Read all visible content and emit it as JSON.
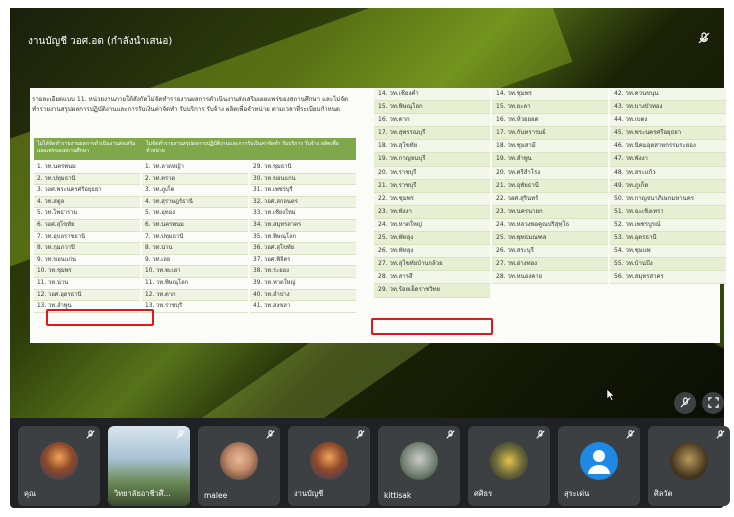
{
  "meeting": {
    "presenter_label": "งานบัญชี วอศ.อด (กำลังนำเสนอ)",
    "mic_off_icon": "mic-off-icon"
  },
  "slide": {
    "intro": "รายละเอียดแบบ 11. หน่วยงานภายใต้สังกัดไม่จัดทำรายงานผลการดำเนินงานส่งเสริมเผยแพร่ของสถานศึกษา และไม่จัดทำรายงานสรุปผลการปฏิบัติงานและการรับเงินค่าจัดทำ รับบริการ รับจ้าง ผลิตเพื่อจำหน่าย ตามเวลาที่ระเบียบกำหนด",
    "header_left": "ไม่ได้จัดทำรายงานผลการดำเนินงานส่งเสริมเผยแพร่ของสถานศึกษา",
    "header_mid": "ไม่จัดทำรายงานสรุปผลการปฏิบัติงานและการรับเงินค่าจัดทำ รับบริการ รับจ้าง ผลิตเพื่อจำหน่าย",
    "col1": [
      "1. วท.นครพนม",
      "2. วท.ปทุมธานี",
      "3. วอศ.พระนครศรีอยุธยา",
      "4. วท.สตูล",
      "5. วท.โพธาราม",
      "6. วอศ.สุโขทัย",
      "7. วท.อุบลราชธานี",
      "8. วท.กุมภวาปี",
      "9. วท.ขอนแก่น",
      "10. วท.ชุมพร",
      "11. วท.น่าน",
      "12. วอศ.อุดรธานี",
      "13. วท.ลำพูน"
    ],
    "col2": [
      "1. วท.ลาดหญ้า",
      "2. วท.ตราด",
      "3. วท.ภูเก็ต",
      "4. วท.สุราษฎร์ธานี",
      "5. วท.อุทอง",
      "6. วท.นครพนม",
      "7. วท.ปทุมธานี",
      "8. วท.น่าน",
      "9. วท.เลย",
      "10. วท.พะเยา",
      "11. วท.พิษณุโลก",
      "12. วท.ตาก",
      "13. วท.ราชบุรี"
    ],
    "col3": [
      "29. วท.ชุมธานี",
      "30. วท.ขอนแก่น",
      "31. วท.เพชรบุรี",
      "32. วอศ.สกลนคร",
      "33. วท.เชียงใหม่",
      "34. วท.สมุทรสาคร",
      "35. วท.พิษณุโลก",
      "36. วอศ.สุโขทัย",
      "37. วอศ.พิจิตร",
      "38. วท.ระยอง",
      "39. วท.หาดใหญ่",
      "40. วท.ลำปาง",
      "41. วท.สงขลา"
    ],
    "rcol1": [
      "14. วท.เชียงคำ",
      "15. วท.พิษณุโลก",
      "16. วท.ตาก",
      "17. วท.สุพรรณบุรี",
      "18. วท.สุโขทัย",
      "19. วท.กาญจนบุรี",
      "20. วท.ราชบุรี",
      "21. วท.ราชบุรี",
      "22. วท.ชุมพร",
      "23. วท.พังงา",
      "24. วท.หาดใหญ่",
      "25. วท.พัทลุง",
      "26. วท.พัทลุง",
      "27. วท.สุโขทัยบ้านกล้วย",
      "28. วท.สารสี",
      "29. วท.ร้อยเอ็ดราชวิทย"
    ],
    "rcol2": [
      "14. วท.ชุมพร",
      "15. วท.ยะลา",
      "16. วท.ห้วยยอด",
      "17. วท.กันทรารมย์",
      "18. วท.ชุมสามี",
      "19. วท.ลำพูน",
      "20. วท.ศรีสำโรง",
      "21. วท.อุทัยธานี",
      "22. วอศ.สุรินทร์",
      "23. วท.นครนายก",
      "24. วท.หลวงพ่อคูณปริสุทฺโธ",
      "25. วท.พุทธมณฑล",
      "26. วท.สระบุรี",
      "27. วท.อ่างทอง",
      "28. วท.หนองคาย"
    ],
    "rcol3": [
      "42. วท.ควนขนุน",
      "43. วท.บางบัวทอง",
      "44. วท.เบตง",
      "45. วท.พระนครศรีอยุธยา",
      "46. วท.นิคมอุตสาหกรรมระยอง",
      "47. วท.พังงา",
      "48. วท.สระแก้ว",
      "49. วท.ภูเก็ต",
      "50. วท.กาญจนาภิเษกมหานคร",
      "51. วท.ฉะเชิงเทรา",
      "52. วท.เพชรบูรณ์",
      "53. วท.อุดรธานี",
      "54. วท.ชุมแพ",
      "55. วท.บ้านบึง",
      "56. วท.สมุทรสาคร"
    ]
  },
  "participants": [
    {
      "name": "คุณ",
      "avatar": "avatar-ship"
    },
    {
      "name": "วิทยาลัยอาชีวศึ...",
      "avatar": "video-classroom"
    },
    {
      "name": "malee",
      "avatar": "avatar-woman"
    },
    {
      "name": "งานบัญชี",
      "avatar": "avatar-ship"
    },
    {
      "name": "kittisak",
      "avatar": "avatar-man"
    },
    {
      "name": "ศศิธร",
      "avatar": "avatar-group"
    },
    {
      "name": "สุระเด่น",
      "avatar": "avatar-person"
    },
    {
      "name": "ศิลวัต",
      "avatar": "avatar-man-dark"
    }
  ]
}
